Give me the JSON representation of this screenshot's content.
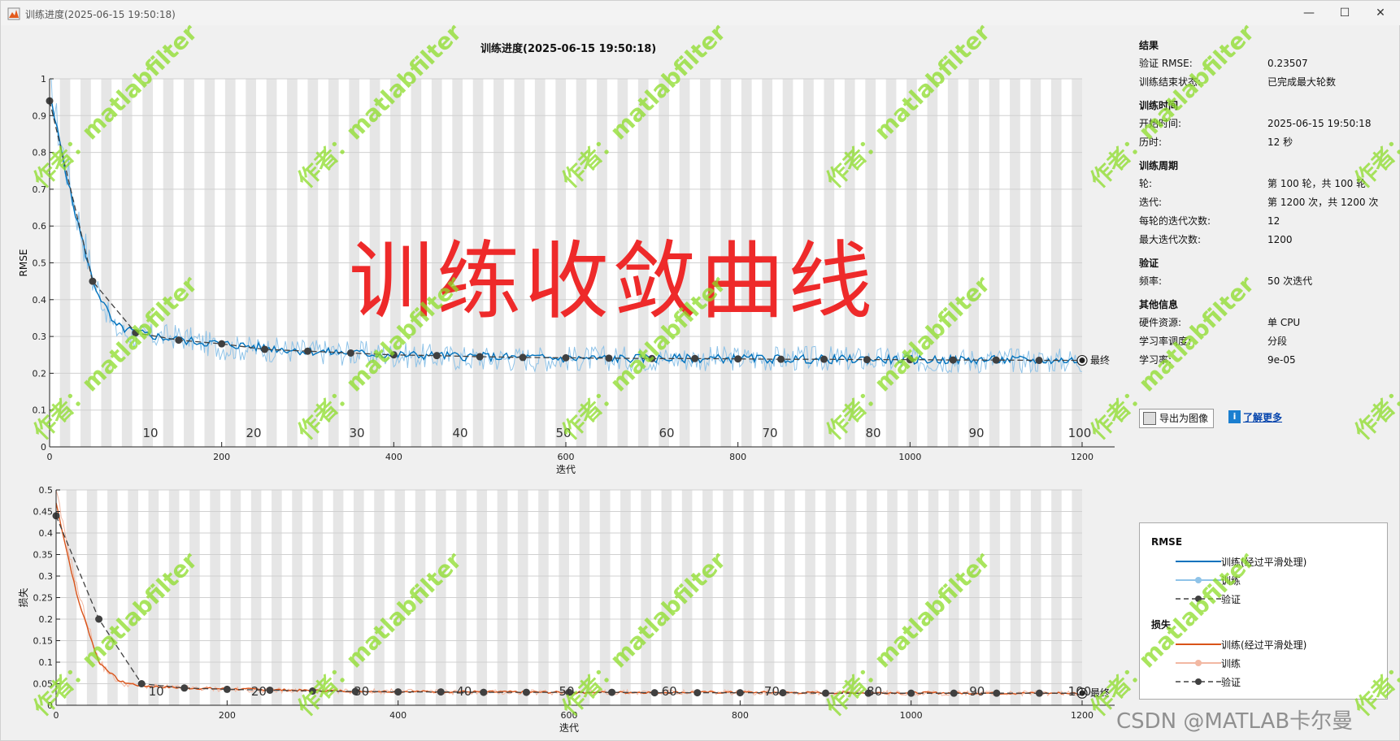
{
  "window": {
    "title": "训练进度(2025-06-15 19:50:18)",
    "buttons": {
      "minimize": "—",
      "maximize": "☐",
      "close": "✕"
    }
  },
  "plot_title": "训练进度(2025-06-15 19:50:18)",
  "overlay_text": "训练收敛曲线",
  "watermark_text": "作者：matlabfilter",
  "csdn_watermark": "CSDN @MATLAB卡尔曼",
  "final_label": "最终",
  "panel": {
    "sections": [
      {
        "title": "结果",
        "rows": [
          {
            "k": "验证 RMSE:",
            "v": "0.23507"
          },
          {
            "k": "训练结束状态:",
            "v": "已完成最大轮数"
          }
        ]
      },
      {
        "title": "训练时间",
        "rows": [
          {
            "k": "开始时间:",
            "v": "2025-06-15 19:50:18"
          },
          {
            "k": "历时:",
            "v": "12 秒"
          }
        ]
      },
      {
        "title": "训练周期",
        "rows": [
          {
            "k": "轮:",
            "v": "第 100 轮，共 100 轮"
          },
          {
            "k": "迭代:",
            "v": "第 1200 次，共 1200 次"
          },
          {
            "k": "每轮的迭代次数:",
            "v": "12"
          },
          {
            "k": "最大迭代次数:",
            "v": "1200"
          }
        ]
      },
      {
        "title": "验证",
        "rows": [
          {
            "k": "频率:",
            "v": "50 次迭代"
          }
        ]
      },
      {
        "title": "其他信息",
        "rows": [
          {
            "k": "硬件资源:",
            "v": "单 CPU"
          },
          {
            "k": "学习率调度:",
            "v": "分段"
          },
          {
            "k": "学习率:",
            "v": "9e-05"
          }
        ]
      }
    ],
    "export_label": "导出为图像",
    "learn_more_label": "了解更多",
    "info_icon": "i"
  },
  "legend": {
    "rmse_title": "RMSE",
    "loss_title": "损失",
    "items_rmse": [
      "训练(经过平滑处理)",
      "训练",
      "验证"
    ],
    "items_loss": [
      "训练(经过平滑处理)",
      "训练",
      "验证"
    ]
  },
  "colors": {
    "rmse_smooth": "#0072bd",
    "rmse_raw": "#8fc3e8",
    "loss_smooth": "#d95319",
    "loss_raw": "#f2b8a2",
    "validation": "#404040",
    "overlay": "#ee2a2a"
  },
  "chart_data": [
    {
      "type": "line",
      "title": "训练进度(2025-06-15 19:50:18)",
      "xlabel": "迭代",
      "ylabel": "RMSE",
      "xlim": [
        0,
        1200
      ],
      "ylim": [
        0,
        1
      ],
      "xticks": [
        0,
        200,
        400,
        600,
        800,
        1000,
        1200
      ],
      "yticks": [
        0,
        0.1,
        0.2,
        0.3,
        0.4,
        0.5,
        0.6,
        0.7,
        0.8,
        0.9,
        1
      ],
      "epoch_labels": [
        10,
        20,
        30,
        40,
        50,
        60,
        70,
        80,
        90,
        100
      ],
      "series": [
        {
          "name": "训练(经过平滑处理)",
          "x": [
            0,
            10,
            25,
            50,
            75,
            100,
            150,
            200,
            300,
            400,
            500,
            600,
            700,
            800,
            900,
            1000,
            1100,
            1200
          ],
          "values": [
            0.95,
            0.85,
            0.68,
            0.45,
            0.33,
            0.31,
            0.29,
            0.28,
            0.26,
            0.25,
            0.245,
            0.24,
            0.24,
            0.24,
            0.238,
            0.237,
            0.236,
            0.235
          ]
        },
        {
          "name": "训练",
          "x": [
            0,
            10,
            25,
            50,
            75,
            100,
            150,
            200,
            300,
            400,
            500,
            600,
            700,
            800,
            900,
            1000,
            1100,
            1200
          ],
          "values": [
            1.0,
            0.86,
            0.7,
            0.46,
            0.32,
            0.3,
            0.3,
            0.27,
            0.26,
            0.25,
            0.24,
            0.24,
            0.24,
            0.24,
            0.24,
            0.235,
            0.235,
            0.235
          ]
        },
        {
          "name": "验证",
          "x": [
            0,
            50,
            100,
            150,
            200,
            250,
            300,
            350,
            400,
            450,
            500,
            550,
            600,
            650,
            700,
            750,
            800,
            850,
            900,
            950,
            1000,
            1050,
            1100,
            1150,
            1200
          ],
          "values": [
            0.94,
            0.45,
            0.31,
            0.29,
            0.28,
            0.265,
            0.26,
            0.255,
            0.25,
            0.248,
            0.245,
            0.243,
            0.242,
            0.241,
            0.24,
            0.24,
            0.239,
            0.238,
            0.238,
            0.237,
            0.237,
            0.236,
            0.236,
            0.235,
            0.235
          ]
        }
      ]
    },
    {
      "type": "line",
      "xlabel": "迭代",
      "ylabel": "损失",
      "xlim": [
        0,
        1200
      ],
      "ylim": [
        0,
        0.5
      ],
      "xticks": [
        0,
        200,
        400,
        600,
        800,
        1000,
        1200
      ],
      "yticks": [
        0,
        0.05,
        0.1,
        0.15,
        0.2,
        0.25,
        0.3,
        0.35,
        0.4,
        0.45,
        0.5
      ],
      "epoch_labels": [
        10,
        20,
        30,
        40,
        50,
        60,
        70,
        80,
        90,
        100
      ],
      "series": [
        {
          "name": "训练(经过平滑处理)",
          "x": [
            0,
            10,
            25,
            50,
            75,
            100,
            150,
            200,
            300,
            400,
            500,
            600,
            700,
            800,
            900,
            1000,
            1100,
            1200
          ],
          "values": [
            0.47,
            0.38,
            0.25,
            0.1,
            0.055,
            0.045,
            0.04,
            0.038,
            0.034,
            0.032,
            0.031,
            0.03,
            0.03,
            0.03,
            0.029,
            0.029,
            0.028,
            0.028
          ]
        },
        {
          "name": "训练",
          "x": [
            0,
            10,
            25,
            50,
            75,
            100,
            150,
            200,
            300,
            400,
            500,
            600,
            700,
            800,
            900,
            1000,
            1100,
            1200
          ],
          "values": [
            0.5,
            0.4,
            0.27,
            0.1,
            0.05,
            0.045,
            0.04,
            0.037,
            0.033,
            0.032,
            0.03,
            0.03,
            0.03,
            0.03,
            0.029,
            0.028,
            0.028,
            0.028
          ]
        },
        {
          "name": "验证",
          "x": [
            0,
            50,
            100,
            150,
            200,
            250,
            300,
            350,
            400,
            450,
            500,
            550,
            600,
            650,
            700,
            750,
            800,
            850,
            900,
            950,
            1000,
            1050,
            1100,
            1150,
            1200
          ],
          "values": [
            0.44,
            0.2,
            0.05,
            0.04,
            0.037,
            0.035,
            0.033,
            0.032,
            0.031,
            0.031,
            0.03,
            0.03,
            0.03,
            0.03,
            0.029,
            0.029,
            0.029,
            0.029,
            0.028,
            0.028,
            0.028,
            0.028,
            0.028,
            0.028,
            0.028
          ]
        }
      ]
    }
  ]
}
